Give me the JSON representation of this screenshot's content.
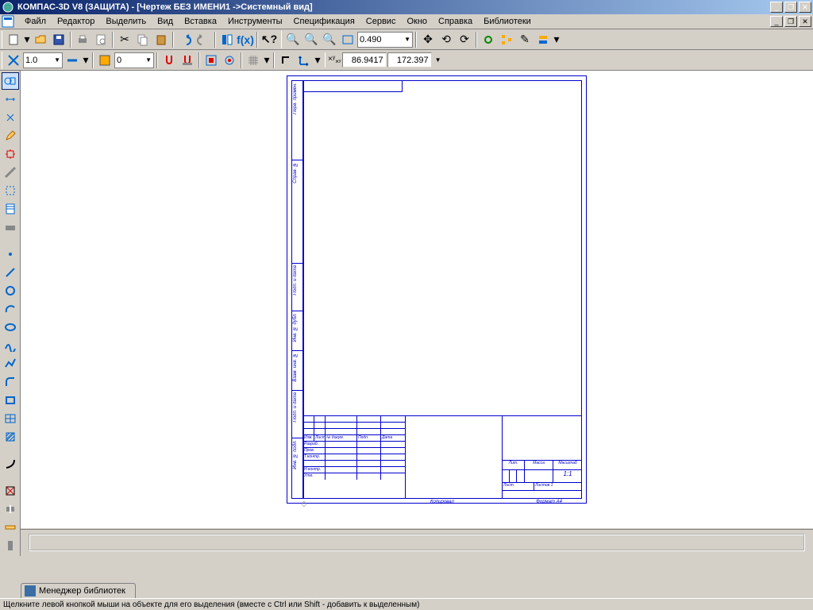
{
  "title": "КОМПАС-3D V8 (ЗАЩИТА) - [Чертеж БЕЗ ИМЕНИ1 ->Системный вид]",
  "sys": {
    "min": "_",
    "max": "❐",
    "close": "✕"
  },
  "menu": [
    "Файл",
    "Редактор",
    "Выделить",
    "Вид",
    "Вставка",
    "Инструменты",
    "Спецификация",
    "Сервис",
    "Окно",
    "Справка",
    "Библиотеки"
  ],
  "mdi": {
    "min": "_",
    "max": "❐",
    "close": "✕"
  },
  "tb1": {
    "zoom_value": "0.490"
  },
  "tb2": {
    "scale_value": "1.0",
    "layer_value": "0",
    "coord_x": "86.9417",
    "coord_y": "172.397"
  },
  "stamp": {
    "header": [
      "Изм.",
      "Лист",
      "№ докум.",
      "Подп.",
      "Дата"
    ],
    "rows": [
      "Разраб.",
      "Пров.",
      "Т.контр.",
      "",
      "Н.контр.",
      "Утв."
    ],
    "lit": "Лит.",
    "massa": "Масса",
    "mashtab": "Масштаб",
    "scale": "1:1",
    "list_lbl": "Лист",
    "listov_lbl": "Листов 1",
    "kop": "Копировал",
    "format": "Формат   A4",
    "side": [
      "Перв. примен.",
      "Справ. №",
      "Подп. и дата",
      "Инв. № дубл.",
      "Взам. инв. №",
      "Подп. и дата",
      "Инв. № подл."
    ]
  },
  "libtab": "Менеджер библиотек",
  "status": "Щелкните левой кнопкой мыши на объекте для его выделения (вместе с Ctrl или Shift - добавить к выделенным)"
}
